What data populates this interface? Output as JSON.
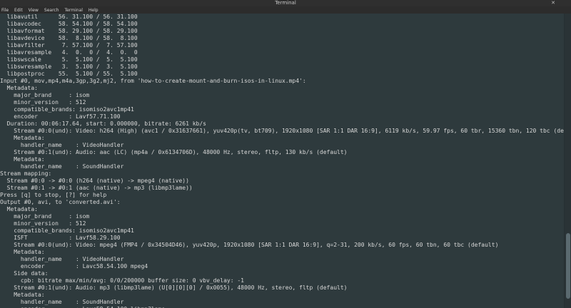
{
  "window": {
    "title": "Terminal",
    "close_glyph": "✕"
  },
  "menu": [
    "File",
    "Edit",
    "View",
    "Search",
    "Terminal",
    "Help"
  ],
  "terminal_lines": [
    "  libavutil      56. 31.100 / 56. 31.100",
    "  libavcodec     58. 54.100 / 58. 54.100",
    "  libavformat    58. 29.100 / 58. 29.100",
    "  libavdevice    58.  8.100 / 58.  8.100",
    "  libavfilter     7. 57.100 /  7. 57.100",
    "  libavresample   4.  0.  0 /  4.  0.  0",
    "  libswscale      5.  5.100 /  5.  5.100",
    "  libswresample   3.  5.100 /  3.  5.100",
    "  libpostproc    55.  5.100 / 55.  5.100",
    "Input #0, mov,mp4,m4a,3gp,3g2,mj2, from 'how-to-create-mount-and-burn-isos-in-linux.mp4':",
    "  Metadata:",
    "    major_brand     : isom",
    "    minor_version   : 512",
    "    compatible_brands: isomiso2avc1mp41",
    "    encoder         : Lavf57.71.100",
    "  Duration: 00:06:17.64, start: 0.000000, bitrate: 6261 kb/s",
    "    Stream #0:0(und): Video: h264 (High) (avc1 / 0x31637661), yuv420p(tv, bt709), 1920x1080 [SAR 1:1 DAR 16:9], 6119 kb/s, 59.97 fps, 60 tbr, 15360 tbn, 120 tbc (default)",
    "    Metadata:",
    "      handler_name    : VideoHandler",
    "    Stream #0:1(und): Audio: aac (LC) (mp4a / 0x6134706D), 48000 Hz, stereo, fltp, 130 kb/s (default)",
    "    Metadata:",
    "      handler_name    : SoundHandler",
    "Stream mapping:",
    "  Stream #0:0 -> #0:0 (h264 (native) -> mpeg4 (native))",
    "  Stream #0:1 -> #0:1 (aac (native) -> mp3 (libmp3lame))",
    "Press [q] to stop, [?] for help",
    "Output #0, avi, to 'converted.avi':",
    "  Metadata:",
    "    major_brand     : isom",
    "    minor_version   : 512",
    "    compatible_brands: isomiso2avc1mp41",
    "    ISFT            : Lavf58.29.100",
    "    Stream #0:0(und): Video: mpeg4 (FMP4 / 0x34504D46), yuv420p, 1920x1080 [SAR 1:1 DAR 16:9], q=2-31, 200 kb/s, 60 fps, 60 tbn, 60 tbc (default)",
    "    Metadata:",
    "      handler_name    : VideoHandler",
    "      encoder         : Lavc58.54.100 mpeg4",
    "    Side data:",
    "      cpb: bitrate max/min/avg: 0/0/200000 buffer size: 0 vbv_delay: -1",
    "    Stream #0:1(und): Audio: mp3 (libmp3lame) (U[0][0][0] / 0x0055), 48000 Hz, stereo, fltp (default)",
    "    Metadata:",
    "      handler_name    : SoundHandler",
    "      encoder         : Lavc58.54.100 libmp3lame",
    "frame=  241 fps=241 q=24.8 size=    1290kB time=00:00:04.12 bitrate=2559.5kbits/s speed=4.13x"
  ]
}
